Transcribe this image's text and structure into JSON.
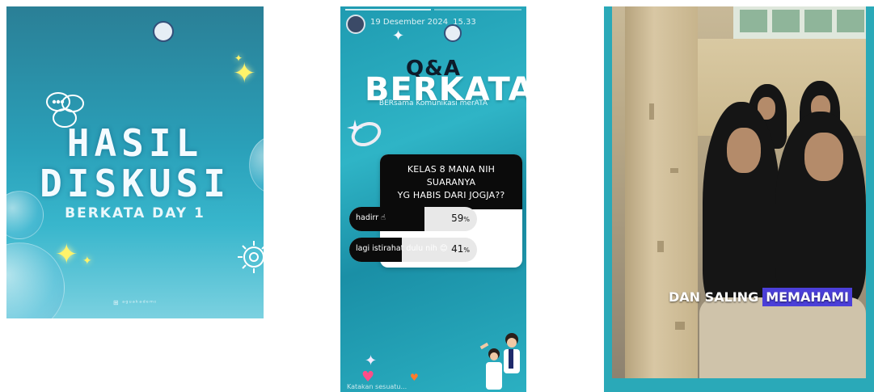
{
  "panel1": {
    "title_line1": "HASIL",
    "title_line2": "DISKUSI",
    "subtitle": "BERKATA DAY 1",
    "footer": "⊞ ᵃᵍᵘᵃᵏᵃᵈᵉᵐᶦ"
  },
  "panel2": {
    "date": "19 Desember 2024",
    "time": "15.33",
    "qa": "Q&A",
    "heading": "BERKATA !",
    "tagline": "BERsama Komunikasi merATA",
    "poll": {
      "question_line1": "KELAS 8 MANA NIH SUARANYA",
      "question_line2": "YG HABIS DARI JOGJA??",
      "options": [
        {
          "label": "hadirr ☝",
          "percent": 59,
          "percent_text": "59",
          "sign": "%"
        },
        {
          "label": "lagi istirahat dulu nih 😊",
          "percent": 41,
          "percent_text": "41",
          "sign": "%"
        }
      ]
    },
    "reply_placeholder": "Katakan sesuatu..."
  },
  "panel3": {
    "caption_plain": "DAN SALING",
    "caption_highlight": "MEMAHAMI",
    "highlight_color": "#4b3fd9"
  }
}
